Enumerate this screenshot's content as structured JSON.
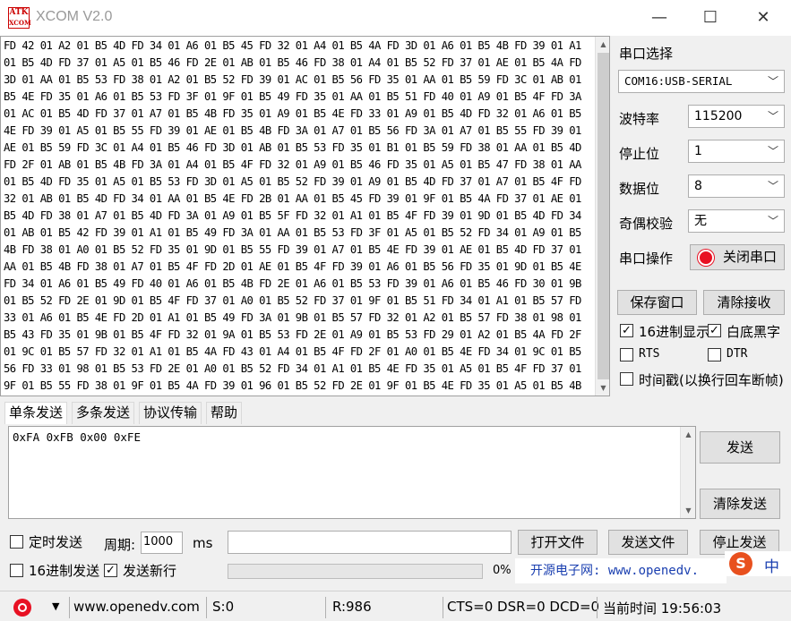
{
  "window": {
    "title": "XCOM V2.0",
    "logo_top": "ATK",
    "logo_bottom": "XCOM",
    "minimize": "—",
    "maximize": "☐",
    "close": "✕"
  },
  "receive": {
    "text": "FD 42 01 A2 01 B5 4D FD 34 01 A6 01 B5 45 FD 32 01 A4 01 B5 4A FD 3D 01 A6 01 B5 4B FD 39 01 A1 01 B5 4D FD 37 01 A5 01 B5 46 FD 2E 01 AB 01 B5 46 FD 38 01 A4 01 B5 52 FD 37 01 AE 01 B5 4A FD 3D 01 AA 01 B5 53 FD 38 01 A2 01 B5 52 FD 39 01 AC 01 B5 56 FD 35 01 AA 01 B5 59 FD 3C 01 AB 01 B5 4E FD 35 01 A6 01 B5 53 FD 3F 01 9F 01 B5 49 FD 35 01 AA 01 B5 51 FD 40 01 A9 01 B5 4F FD 3A 01 AC 01 B5 4D FD 37 01 A7 01 B5 4B FD 35 01 A9 01 B5 4E FD 33 01 A9 01 B5 4D FD 32 01 A6 01 B5 4E FD 39 01 A5 01 B5 55 FD 39 01 AE 01 B5 4B FD 3A 01 A7 01 B5 56 FD 3A 01 A7 01 B5 55 FD 39 01 AE 01 B5 59 FD 3C 01 A4 01 B5 46 FD 3D 01 AB 01 B5 53 FD 35 01 B1 01 B5 59 FD 38 01 AA 01 B5 4D FD 2F 01 AB 01 B5 4B FD 3A 01 A4 01 B5 4F FD 32 01 A9 01 B5 46 FD 35 01 A5 01 B5 47 FD 38 01 AA 01 B5 4D FD 35 01 A5 01 B5 53 FD 3D 01 A5 01 B5 52 FD 39 01 A9 01 B5 4D FD 37 01 A7 01 B5 4F FD 32 01 AB 01 B5 4D FD 34 01 AA 01 B5 4E FD 2B 01 AA 01 B5 45 FD 39 01 9F 01 B5 4A FD 37 01 AE 01 B5 4D FD 38 01 A7 01 B5 4D FD 3A 01 A9 01 B5 5F FD 32 01 A1 01 B5 4F FD 39 01 9D 01 B5 4D FD 34 01 AB 01 B5 42 FD 39 01 A1 01 B5 49 FD 3A 01 AA 01 B5 53 FD 3F 01 A5 01 B5 52 FD 34 01 A9 01 B5 4B FD 38 01 A0 01 B5 52 FD 35 01 9D 01 B5 55 FD 39 01 A7 01 B5 4E FD 39 01 AE 01 B5 4D FD 37 01 AA 01 B5 4B FD 38 01 A7 01 B5 4F FD 2D 01 AE 01 B5 4F FD 39 01 A6 01 B5 56 FD 35 01 9D 01 B5 4E FD 34 01 A6 01 B5 49 FD 40 01 A6 01 B5 4B FD 2E 01 A6 01 B5 53 FD 39 01 A6 01 B5 46 FD 30 01 9B 01 B5 52 FD 2E 01 9D 01 B5 4F FD 37 01 A0 01 B5 52 FD 37 01 9F 01 B5 51 FD 34 01 A1 01 B5 57 FD 33 01 A6 01 B5 4E FD 2D 01 A1 01 B5 49 FD 3A 01 9B 01 B5 57 FD 32 01 A2 01 B5 57 FD 38 01 98 01 B5 43 FD 35 01 9B 01 B5 4F FD 32 01 9A 01 B5 53 FD 2E 01 A9 01 B5 53 FD 29 01 A2 01 B5 4A FD 2F 01 9C 01 B5 57 FD 32 01 A1 01 B5 4A FD 43 01 A4 01 B5 4F FD 2F 01 A0 01 B5 4E FD 34 01 9C 01 B5 56 FD 33 01 98 01 B5 53 FD 2E 01 A0 01 B5 52 FD 34 01 A1 01 B5 4E FD 35 01 A5 01 B5 4F FD 37 01 9F 01 B5 55 FD 38 01 9F 01 B5 4A FD 39 01 96 01 B5 52 FD 2E 01 9F 01 B5 4E FD 35 01 A5 01 B5 4B FD 39 01 98 01 B5 4E FD 33 01 A0 01 B5 5E FD 27 01 9F 01 B5 51 FD 2E 01 9B 01 B5 56 FD 30 01 A5 01 B5 57 FD 2F 01 9A 01 B5 4E FD 32 01 A5 01 B5 53 FD 2E 01 AB 01 B5 55 FD 39 01 A6 01 B5 4E FD 39 01 A6 01 B5 4F FD 34 01 9C 01 B5 4E FD 3D 01 A5 01"
  },
  "panel": {
    "port_label": "串口选择",
    "port_value": "COM16:USB-SERIAL",
    "baud_label": "波特率",
    "baud_value": "115200",
    "stop_label": "停止位",
    "stop_value": "1",
    "data_label": "数据位",
    "data_value": "8",
    "parity_label": "奇偶校验",
    "parity_value": "无",
    "op_label": "串口操作",
    "close_port": "关闭串口",
    "save_window": "保存窗口",
    "clear_receive": "清除接收",
    "hex_display": "16进制显示",
    "white_black": "白底黑字",
    "rts": "RTS",
    "dtr": "DTR",
    "timestamp": "时间戳(以换行回车断帧)"
  },
  "tabs": [
    "单条发送",
    "多条发送",
    "协议传输",
    "帮助"
  ],
  "send": {
    "text": "0xFA 0xFB 0x00 0xFE",
    "send_button": "发送",
    "clear_send": "清除发送",
    "timed_send": "定时发送",
    "period_label": "周期:",
    "period_value": "1000",
    "period_unit": "ms",
    "open_file": "打开文件",
    "send_file": "发送文件",
    "stop_send": "停止发送",
    "hex_send": "16进制发送",
    "send_newline": "发送新行",
    "progress_text": "0%",
    "progress": 0,
    "banner": "开源电子网: www.openedv."
  },
  "ime": {
    "brand": "S",
    "mode": "中"
  },
  "status": {
    "site": "www.openedv.com",
    "sent": "S:0",
    "received": "R:986",
    "lines": "CTS=0 DSR=0 DCD=0",
    "time": "当前时间 19:56:03"
  },
  "colors": {
    "accent": "#0078d7",
    "record": "#e81123",
    "banner": "#1a3fb0"
  }
}
